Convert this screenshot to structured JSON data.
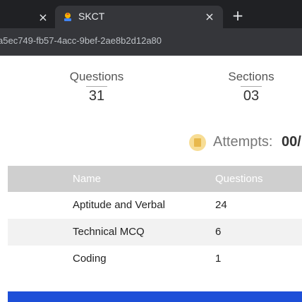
{
  "browser": {
    "prev_tab_close": "×",
    "active_tab": {
      "title": "SKCT",
      "close": "×"
    },
    "new_tab": "+",
    "url": "a5ec749-fb57-4acc-9bef-2ae8b2d12a80"
  },
  "stats": {
    "questions": {
      "label": "Questions",
      "value": "31"
    },
    "sections": {
      "label": "Sections",
      "value": "03"
    }
  },
  "attempts": {
    "label": "Attempts:",
    "value": "00/"
  },
  "table": {
    "headers": [
      "Name",
      "Questions"
    ],
    "rows": [
      {
        "name": "Aptitude and Verbal",
        "questions": "24"
      },
      {
        "name": "Technical MCQ",
        "questions": "6"
      },
      {
        "name": "Coding",
        "questions": "1"
      }
    ]
  },
  "colors": {
    "accent": "#1d4fd8",
    "header_bg": "#cfcfcf",
    "attempts_icon": "#f7dd95"
  }
}
